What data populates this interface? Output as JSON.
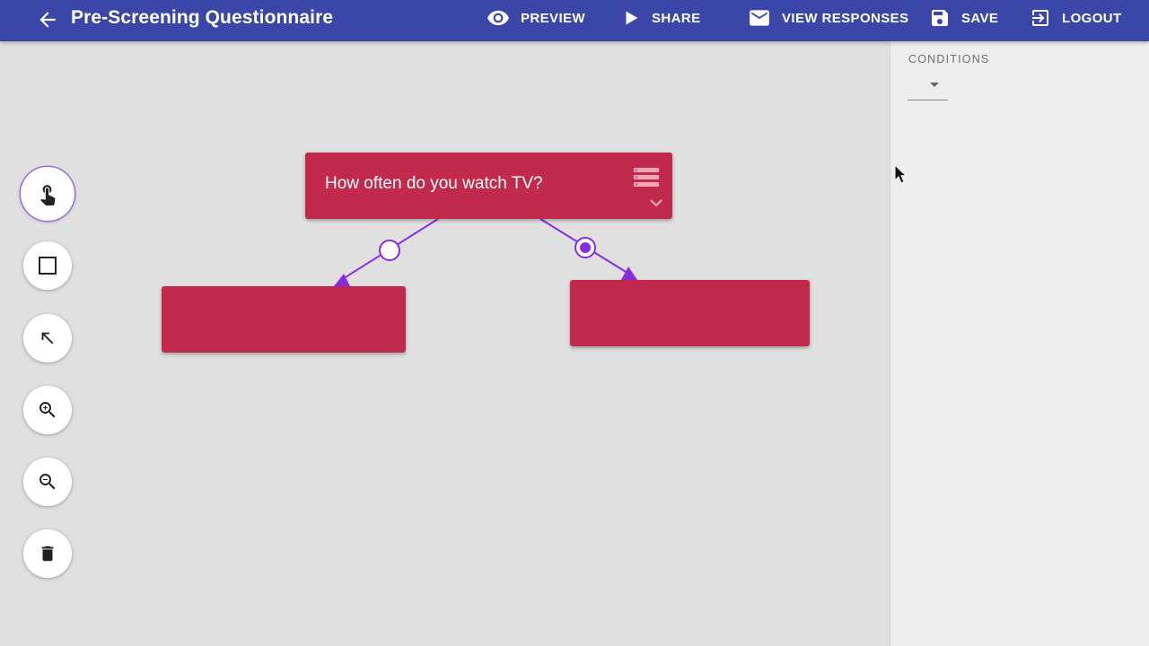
{
  "header": {
    "title": "Pre-Screening Questionnaire",
    "back_icon": "arrow-back-icon",
    "actions": [
      {
        "id": "preview",
        "label": "PREVIEW",
        "icon": "eye-icon"
      },
      {
        "id": "share",
        "label": "SHARE",
        "icon": "play-icon"
      },
      {
        "id": "responses",
        "label": "VIEW RESPONSES",
        "icon": "mail-icon"
      },
      {
        "id": "save",
        "label": "SAVE",
        "icon": "floppy-disk-icon"
      },
      {
        "id": "logout",
        "label": "LOGOUT",
        "icon": "exit-icon"
      }
    ],
    "color": "#3b47a8"
  },
  "toolbar": {
    "tools": [
      {
        "id": "pan",
        "icon": "hand-pointer-icon",
        "active": true
      },
      {
        "id": "add-node",
        "icon": "square-icon",
        "active": false
      },
      {
        "id": "add-edge",
        "icon": "arrow-up-left-icon",
        "active": false
      },
      {
        "id": "zoom-in",
        "icon": "zoom-in-icon",
        "active": false
      },
      {
        "id": "zoom-out",
        "icon": "zoom-out-icon",
        "active": false
      },
      {
        "id": "delete",
        "icon": "trash-icon",
        "active": false
      }
    ]
  },
  "graph": {
    "node_color": "#c12a4c",
    "edge_color": "#8a2be2",
    "nodes": [
      {
        "id": "question",
        "text": "How often do you watch TV?",
        "type_icon": "list-icon",
        "expand_icon": "chevron-down-icon"
      },
      {
        "id": "left",
        "text": ""
      },
      {
        "id": "right",
        "text": ""
      }
    ],
    "edges": [
      {
        "from": "question",
        "to": "left",
        "selected": false
      },
      {
        "from": "question",
        "to": "right",
        "selected": true
      }
    ]
  },
  "panel": {
    "conditions_label": "CONDITIONS",
    "conditions_value": ""
  }
}
